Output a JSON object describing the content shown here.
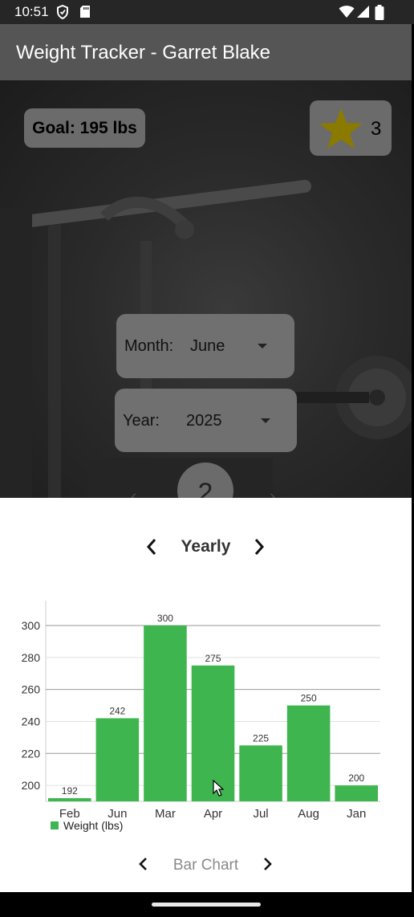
{
  "status_bar": {
    "time": "10:51"
  },
  "app_bar": {
    "title": "Weight Tracker - Garret Blake"
  },
  "goal": {
    "label": "Goal: 195 lbs"
  },
  "stars": {
    "count": "3",
    "color": "#8a7a00"
  },
  "month_select": {
    "label": "Month:",
    "value": "June"
  },
  "year_select": {
    "label": "Year:",
    "value": "2025"
  },
  "page_indicator": {
    "value": "2"
  },
  "period_nav": {
    "label": "Yearly"
  },
  "chart_type_nav": {
    "label": "Bar Chart"
  },
  "colors": {
    "bar": "#3fb54f",
    "app_bar": "#555555",
    "chip": "#6b6b6b"
  },
  "chart_data": {
    "type": "bar",
    "categories": [
      "Feb",
      "Jun",
      "Mar",
      "Apr",
      "Jul",
      "Aug",
      "Jan"
    ],
    "series": [
      {
        "name": "Weight (lbs)",
        "values": [
          192,
          242,
          300,
          275,
          225,
          250,
          200
        ]
      }
    ],
    "yticks": [
      200,
      220,
      240,
      260,
      280,
      300
    ],
    "ylim": [
      190,
      300
    ],
    "legend": "bottom-left",
    "grid": true
  }
}
